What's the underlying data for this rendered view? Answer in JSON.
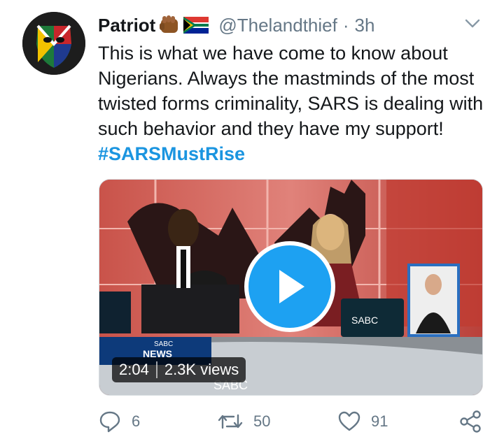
{
  "tweet": {
    "display_name": "Patriot",
    "handle": "@Thelandthief",
    "separator": "·",
    "time": "3h",
    "text": "This is what we have come to know about Nigerians. Always the mastminds of the most twisted forms criminality, SARS is dealing with such behavior and they have my support!",
    "hashtag": "#SARSMustRise",
    "icons": {
      "emoji_1": "raised-fist-icon",
      "emoji_2": "south-africa-flag-icon",
      "caret": "chevron-down-icon"
    }
  },
  "media": {
    "duration": "2:04",
    "views": "2.3K views",
    "overlay_text": {
      "channel": "SABC",
      "channel_brand": "NEWS",
      "desk_logo": "SABC",
      "lower_logo": "SABC"
    }
  },
  "actions": {
    "reply_count": "6",
    "retweet_count": "50",
    "like_count": "91"
  },
  "colors": {
    "accent": "#1da1f2",
    "hashtag": "#1b95e0",
    "secondary_text": "#657786"
  }
}
